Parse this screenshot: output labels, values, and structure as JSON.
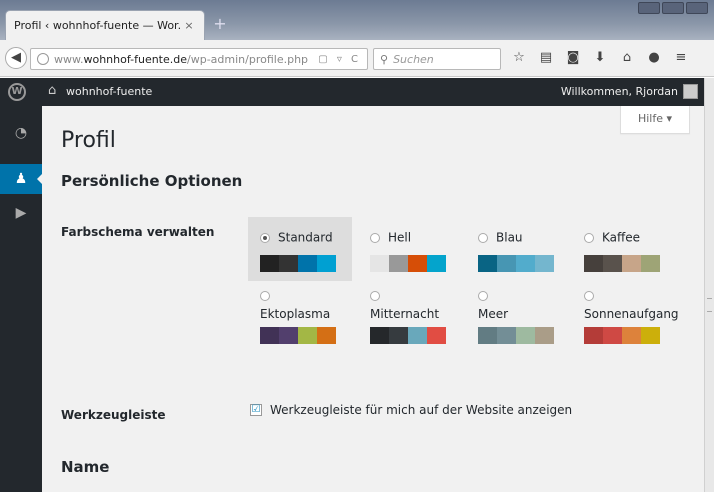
{
  "browser": {
    "tab_title": "Profil ‹ wohnhof-fuente — Wor...",
    "tab_close": "×",
    "new_tab": "+",
    "back": "◀",
    "url_prefix": "www.",
    "url_domain": "wohnhof-fuente.de",
    "url_path": "/wp-admin/profile.php",
    "url_icons": "▢ ▿ C",
    "search_placeholder": "Suchen",
    "search_glyph": "⚲",
    "toolbar_icons": [
      {
        "name": "bookmark-star-icon",
        "glyph": "☆"
      },
      {
        "name": "reading-list-icon",
        "glyph": "▤"
      },
      {
        "name": "pocket-icon",
        "glyph": "◙"
      },
      {
        "name": "download-icon",
        "glyph": "⬇"
      },
      {
        "name": "home-icon",
        "glyph": "⌂"
      },
      {
        "name": "chat-icon",
        "glyph": "●"
      },
      {
        "name": "menu-icon",
        "glyph": "≡"
      }
    ]
  },
  "adminbar": {
    "wp_logo": "W",
    "home_glyph": "⌂",
    "site_name": "wohnhof-fuente",
    "welcome": "Willkommen, Rjordan"
  },
  "sidebar": {
    "items": [
      {
        "name": "dashboard-icon",
        "glyph": "◔",
        "active": false
      },
      {
        "name": "users-icon",
        "glyph": "♟",
        "active": true
      },
      {
        "name": "media-play-icon",
        "glyph": "▶",
        "active": false
      }
    ]
  },
  "main": {
    "help": "Hilfe ▾",
    "page_title": "Profil",
    "section_title": "Persönliche Optionen",
    "color_scheme_label": "Farbschema verwalten",
    "toolbar_label": "Werkzeugleiste",
    "toolbar_checkbox_text": "Werkzeugleiste für mich auf der Website anzeigen",
    "toolbar_checked": "☑",
    "name_heading": "Name"
  },
  "color_schemes": [
    {
      "label": "Standard",
      "selected": true,
      "colors": [
        "#222222",
        "#333333",
        "#0073aa",
        "#00a0d2"
      ]
    },
    {
      "label": "Hell",
      "selected": false,
      "colors": [
        "#e5e5e5",
        "#999999",
        "#d64e07",
        "#04a4cc"
      ]
    },
    {
      "label": "Blau",
      "selected": false,
      "colors": [
        "#096484",
        "#4796b3",
        "#52accc",
        "#74b6ce"
      ]
    },
    {
      "label": "Kaffee",
      "selected": false,
      "colors": [
        "#46403c",
        "#59524c",
        "#c7a589",
        "#9ea476"
      ]
    },
    {
      "label": "Ektoplasma",
      "selected": false,
      "colors": [
        "#413256",
        "#523f6d",
        "#a3b745",
        "#d46f15"
      ]
    },
    {
      "label": "Mitternacht",
      "selected": false,
      "colors": [
        "#25282b",
        "#363b3f",
        "#69a8bb",
        "#e14d43"
      ]
    },
    {
      "label": "Meer",
      "selected": false,
      "colors": [
        "#627c83",
        "#738e96",
        "#9ebaa0",
        "#aa9d88"
      ]
    },
    {
      "label": "Sonnenaufgang",
      "selected": false,
      "colors": [
        "#b43c38",
        "#cf4944",
        "#dd823b",
        "#ccaf0b"
      ]
    }
  ]
}
